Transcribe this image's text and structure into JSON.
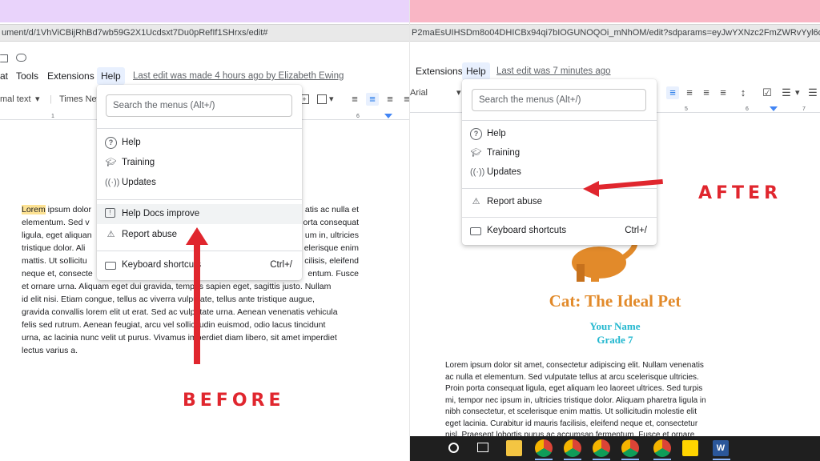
{
  "colors": {
    "left_top_band": "#e9d3fb",
    "right_top_band": "#f9b6c5",
    "accent_red": "#e0262e",
    "title_orange": "#e28a2a",
    "subtitle_cyan": "#22b7cf",
    "highlight_yellow": "#fde293",
    "google_blue": "#1a73e8"
  },
  "before": {
    "url": "ument/d/1VhViCBijRhBd7wb59G2X1Ucdsxt7Du0pRefIf1SHrxs/edit#",
    "menubar": {
      "items": [
        "at",
        "Tools",
        "Extensions",
        "Help"
      ],
      "last_edit": "Last edit was made 4 hours ago by Elizabeth Ewing"
    },
    "toolbar": {
      "style_select": "mal text",
      "font_select": "Times New"
    },
    "ruler_ticks": [
      "1",
      "6"
    ],
    "help_menu": {
      "search_placeholder": "Search the menus (Alt+/)",
      "items": [
        {
          "label": "Help",
          "icon": "help-circle-icon"
        },
        {
          "label": "Training",
          "icon": "graduation-cap-icon"
        },
        {
          "label": "Updates",
          "icon": "broadcast-icon"
        },
        {
          "label": "Help Docs improve",
          "icon": "feedback-icon"
        },
        {
          "label": "Report abuse",
          "icon": "warning-triangle-icon"
        },
        {
          "label": "Keyboard shortcuts",
          "shortcut": "Ctrl+/",
          "icon": "keyboard-icon"
        }
      ]
    },
    "doc_text": {
      "highlighted_word": "Lorem",
      "lines_left": [
        " ipsum dolor",
        "elementum. Sed v",
        "ligula, eget aliquan",
        "tristique dolor. Ali",
        "mattis. Ut sollicitu",
        "neque et, consecte",
        "et ornare urna. Aliquam eget dui gravida, tempus sapien eget, sagittis justo. Nullam",
        "id elit nisi. Etiam congue, tellus ac viverra vulputate, tellus ante tristique augue,",
        "gravida convallis lorem elit ut erat. Sed ac vulputate urna. Aenean venenatis vehicula",
        "felis sed rutrum. Aenean feugiat, arcu vel sollicitudin euismod, odio lacus tincidunt",
        "urna, ac lacinia nunc velit ut purus. Vivamus imperdiet diam libero, sit amet imperdiet",
        "lectus varius a."
      ],
      "lines_right": [
        "atis ac nulla et",
        "orta consequat",
        "um in, ultricies",
        "elerisque enim",
        "cilisis, eleifend",
        "entum. Fusce"
      ]
    },
    "caption": "BEFORE"
  },
  "after": {
    "url": "P2maEsUIHSDm8o04DHICBx94qi7bIOGUNOQOi_mNhOM/edit?sdparams=eyJwYXNzc2FmZWRvYyl6dHJ1ZSwi",
    "menubar": {
      "items": [
        "Extensions",
        "Help"
      ],
      "last_edit": "Last edit was 7 minutes ago"
    },
    "toolbar": {
      "font_select": "Arial"
    },
    "ruler_ticks": [
      "5",
      "6",
      "7"
    ],
    "help_menu": {
      "search_placeholder": "Search the menus (Alt+/)",
      "items": [
        {
          "label": "Help",
          "icon": "help-circle-icon"
        },
        {
          "label": "Training",
          "icon": "graduation-cap-icon"
        },
        {
          "label": "Updates",
          "icon": "broadcast-icon"
        },
        {
          "label": "Report abuse",
          "icon": "warning-triangle-icon"
        },
        {
          "label": "Keyboard shortcuts",
          "shortcut": "Ctrl+/",
          "icon": "keyboard-icon"
        }
      ]
    },
    "document": {
      "title": "Cat: The Ideal Pet",
      "name": "Your Name",
      "grade": "Grade 7",
      "paragraph_lines": [
        "Lorem ipsum dolor sit amet, consectetur adipiscing elit. Nullam venenatis",
        "ac nulla et elementum. Sed vulputate tellus at arcu scelerisque ultricies.",
        "Proin porta consequat ligula, eget aliquam leo laoreet ultrices. Sed turpis",
        "mi, tempor nec ipsum in, ultricies tristique dolor. Aliquam pharetra ligula in",
        "nibh consectetur, et scelerisque enim mattis. Ut sollicitudin molestie elit",
        "eget lacinia. Curabitur id mauris facilisis, eleifend neque et, consectetur",
        "nisl. Praesent lobortis purus ac accumsan fermentum. Fusce et ornare"
      ]
    },
    "caption": "AFTER",
    "taskbar": [
      "windows-search-icon",
      "task-view-icon",
      "file-explorer-icon",
      "chrome-icon",
      "chrome-icon",
      "chrome-icon",
      "chrome-icon",
      "chrome-icon",
      "sticky-notes-icon",
      "word-icon"
    ]
  }
}
